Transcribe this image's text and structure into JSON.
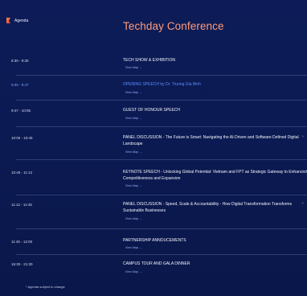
{
  "header": {
    "tab_label": "Agenda",
    "title": "Techday Conference"
  },
  "agenda": [
    {
      "time": "8:30 - 9:30",
      "title": "TECH SHOW & EXHIBITION",
      "map": "View Map →",
      "highlight": false
    },
    {
      "time": "9:30 - 9:47",
      "title": "OPENING SPEECH by Dr. Truong Gia Binh",
      "map": "View Map →",
      "highlight": true
    },
    {
      "time": "9:47 - 10:05",
      "title": "GUEST OF HONOUR SPEECH",
      "map": "View Map →",
      "highlight": false
    },
    {
      "time": "10:05 - 10:45",
      "title": "PANEL DISCUSSION - The Future is Smart: Navigating the AI-Driven and Software-Defined Digital Landscape",
      "map": "View Map →",
      "highlight": false
    },
    {
      "time": "10:45 - 11:12",
      "title": "KEYNOTE SPEECH - Unlocking Global Potential: Vietnam and FPT as Strategic Gateway to Enhanced Competitiveness and Expansion",
      "map": "View Map →",
      "highlight": false
    },
    {
      "time": "11:12 - 11:45",
      "title": "PANEL DISCUSSION - Speed, Scale & Accountability - How Digital Transformation Transforms Sustainable Businesses",
      "map": "View Map →",
      "highlight": false
    },
    {
      "time": "11:45 - 12:00",
      "title": "PARTNERSHIP ANNOUCEMENTS",
      "map": "View Map →",
      "highlight": false
    },
    {
      "time": "16:30 - 21:30",
      "title": "CAMPUS TOUR AND GALA DINNER",
      "map": "View Map →",
      "highlight": false
    }
  ],
  "footer": {
    "note": "* Agenda subject to change"
  }
}
